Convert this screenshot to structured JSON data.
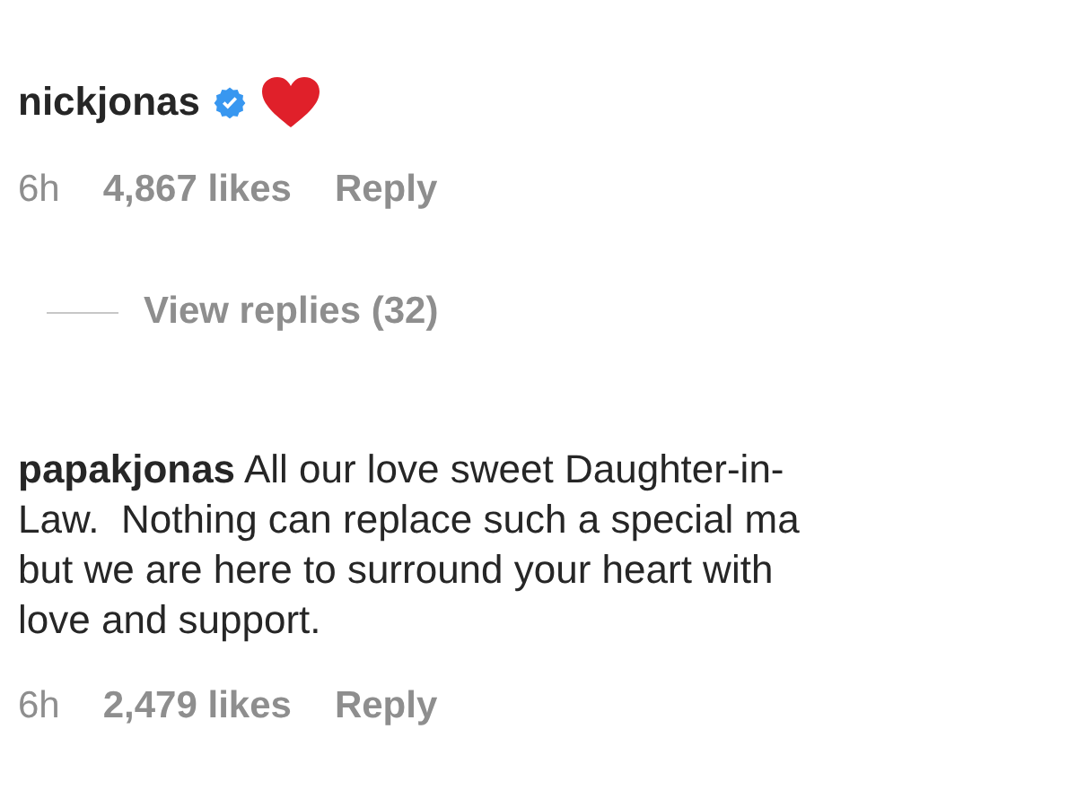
{
  "comments": [
    {
      "username": "nickjonas",
      "verified": true,
      "heart": true,
      "time": "6h",
      "likes": "4,867 likes",
      "reply": "Reply",
      "view_replies": "View replies (32)"
    },
    {
      "username": "papakjonas",
      "text": "All our love sweet Daughter-in-\nLaw.  Nothing can replace such a special ma\nbut we are here to surround your heart with\nlove and support.",
      "time": "6h",
      "likes": "2,479 likes",
      "reply": "Reply"
    }
  ]
}
